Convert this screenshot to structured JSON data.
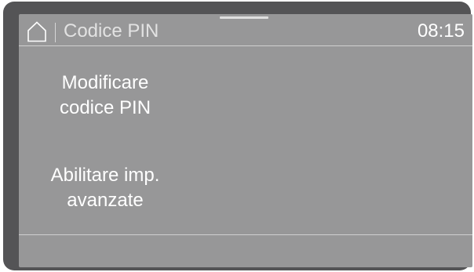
{
  "header": {
    "title": "Codice PIN",
    "time": "08:15",
    "home_icon": "home-icon"
  },
  "menu": {
    "items": [
      {
        "line1": "Modificare",
        "line2": "codice PIN"
      },
      {
        "line1": "Abilitare imp.",
        "line2": "avanzate"
      }
    ]
  },
  "colors": {
    "bezel": "#545456",
    "screen": "#979798",
    "text": "#ffffff",
    "title_text": "#e2e2e2",
    "divider": "#cfcfcf"
  }
}
